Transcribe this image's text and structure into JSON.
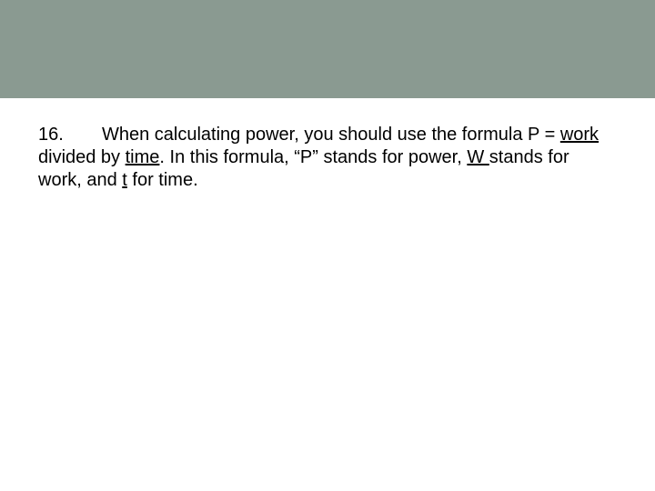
{
  "question": {
    "number": "16.",
    "t1": "When calculating power, you should use the formula ",
    "t2": "P = ",
    "w_work": "work",
    "t3": " divided by ",
    "w_time": "time",
    "t4": ".  In this formula, “P” stands for power, ",
    "w_W": "W ",
    "t5": "stands for work, and ",
    "w_t": "t",
    "t6": " for time."
  }
}
